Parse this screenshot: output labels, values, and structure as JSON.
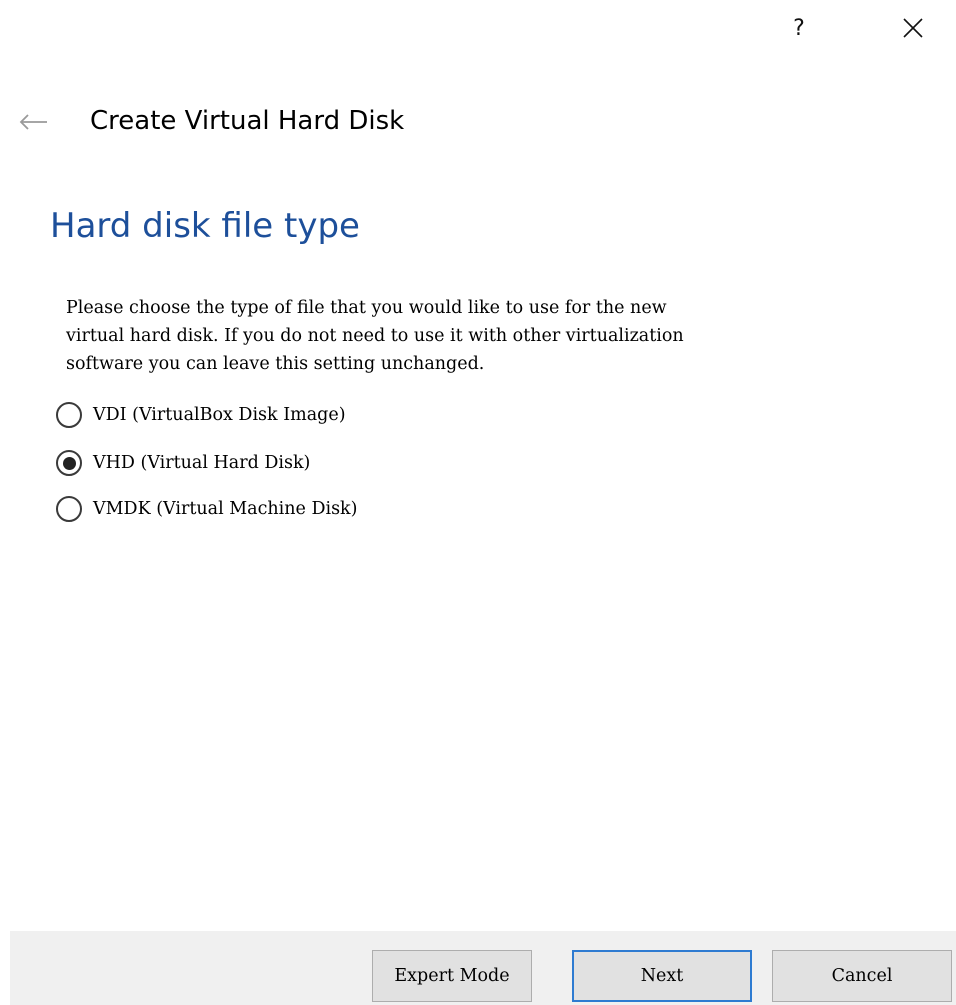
{
  "titlebar": {
    "help_label": "?",
    "close_icon": "close-icon"
  },
  "header": {
    "back_icon": "arrow-left-icon",
    "title": "Create Virtual Hard Disk"
  },
  "page": {
    "heading": "Hard disk file type",
    "description": "Please choose the type of file that you would like to use for the new\nvirtual hard disk. If you do not need to use it with other virtualization\nsoftware you can leave this setting unchanged."
  },
  "options": [
    {
      "label": "VDI (VirtualBox Disk Image)",
      "selected": false
    },
    {
      "label": "VHD (Virtual Hard Disk)",
      "selected": true
    },
    {
      "label": "VMDK (Virtual Machine Disk)",
      "selected": false
    }
  ],
  "footer": {
    "expert_mode_label": "Expert Mode",
    "next_label": "Next",
    "cancel_label": "Cancel"
  },
  "colors": {
    "heading": "#1d4f9a",
    "default_button_border": "#2e7bd1",
    "footer_bg": "#f0f0f0"
  }
}
